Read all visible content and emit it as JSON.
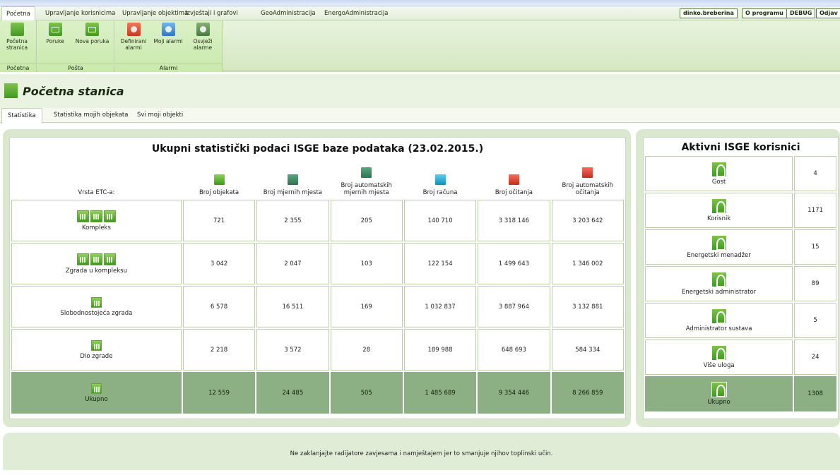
{
  "menu": {
    "items": [
      "Početna",
      "Upravljanje korisnicima",
      "Upravljanje objektima",
      "Izvještaji i grafovi",
      "GeoAdministracija",
      "EnergoAdministracija"
    ],
    "user": "dinko.breberina",
    "about": "O programu",
    "debug": "DEBUG",
    "logout": "Odjav"
  },
  "ribbon": {
    "home_btn_line1": "Početna",
    "home_btn_line2": "stranica",
    "home_group": "Početna",
    "messages": "Poruke",
    "new_message": "Nova poruka",
    "mail_group": "Pošta",
    "defined_alarms_1": "Definirani",
    "defined_alarms_2": "alarmi",
    "my_alarms": "Moji alarmi",
    "refresh_alarms_1": "Osvježi",
    "refresh_alarms_2": "alarme",
    "alarms_group": "Alarmi"
  },
  "page": {
    "title": "Početna stanica"
  },
  "tabs": [
    "Statistika",
    "Statistika mojih objekata",
    "Svi moji objekti"
  ],
  "stats": {
    "title": "Ukupni statistički podaci ISGE baze podataka (23.02.2015.)",
    "row_header": "Vrsta ETC-a:",
    "columns": [
      "Broj objekata",
      "Broj mjernih mjesta",
      "Broj automatskih mjernih mjesta",
      "Broj računa",
      "Broj očitanja",
      "Broj automatskih očitanja"
    ],
    "rows": [
      {
        "label": "Kompleks",
        "values": [
          "721",
          "2 355",
          "205",
          "140 710",
          "3 318 146",
          "3 203 642"
        ]
      },
      {
        "label": "Zgrada u kompleksu",
        "values": [
          "3 042",
          "2 047",
          "103",
          "122 154",
          "1 499 643",
          "1 346 002"
        ]
      },
      {
        "label": "Slobodnostojeća zgrada",
        "values": [
          "6 578",
          "16 511",
          "169",
          "1 032 837",
          "3 887 964",
          "3 132 881"
        ]
      },
      {
        "label": "Dio zgrade",
        "values": [
          "2 218",
          "3 572",
          "28",
          "189 988",
          "648 693",
          "584 334"
        ]
      },
      {
        "label": "Ukupno",
        "values": [
          "12 559",
          "24 485",
          "505",
          "1 485 689",
          "9 354 446",
          "8 266 859"
        ]
      }
    ]
  },
  "users": {
    "title": "Aktivni ISGE korisnici",
    "rows": [
      {
        "label": "Gost",
        "count": "4"
      },
      {
        "label": "Korisnik",
        "count": "1171"
      },
      {
        "label": "Energetski menadžer",
        "count": "15"
      },
      {
        "label": "Energetski administrator",
        "count": "89"
      },
      {
        "label": "Administrator sustava",
        "count": "5"
      },
      {
        "label": "Više uloga",
        "count": "24"
      },
      {
        "label": "Ukupno",
        "count": "1308"
      }
    ]
  },
  "footer": {
    "tip": "Ne zaklanjajte radijatore zavjesama i namještajem jer to smanjuje njihov toplinski učin."
  }
}
